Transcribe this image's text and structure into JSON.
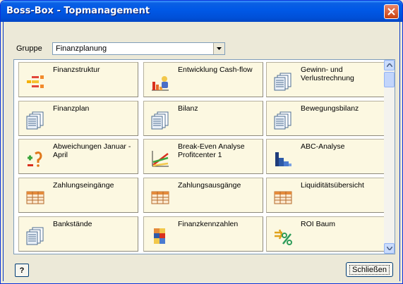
{
  "window": {
    "title": "Boss-Box - Topmanagement"
  },
  "group": {
    "label": "Gruppe",
    "selected": "Finanzplanung"
  },
  "tiles": [
    {
      "label": "Finanzstruktur",
      "icon": "structure-icon"
    },
    {
      "label": "Entwicklung Cash-flow",
      "icon": "chart-person-icon"
    },
    {
      "label": "Gewinn- und Verlustrechnung",
      "icon": "document-stack-icon"
    },
    {
      "label": "Finanzplan",
      "icon": "document-stack-icon"
    },
    {
      "label": "Bilanz",
      "icon": "document-stack-icon"
    },
    {
      "label": "Bewegungsbilanz",
      "icon": "document-stack-icon"
    },
    {
      "label": "Abweichungen Januar - April",
      "icon": "deviation-icon"
    },
    {
      "label": "Break-Even Analyse Profitcenter 1",
      "icon": "break-even-icon"
    },
    {
      "label": "ABC-Analyse",
      "icon": "abc-bars-icon"
    },
    {
      "label": "Zahlungseingänge",
      "icon": "table-icon"
    },
    {
      "label": "Zahlungsausgänge",
      "icon": "table-icon"
    },
    {
      "label": "Liquiditätsübersicht",
      "icon": "table-icon"
    },
    {
      "label": "Bankstände",
      "icon": "document-stack-icon"
    },
    {
      "label": "Finanzkennzahlen",
      "icon": "kpi-icon"
    },
    {
      "label": "ROI Baum",
      "icon": "percent-icon"
    }
  ],
  "footer": {
    "help": "?",
    "close_label": "Schließen"
  }
}
